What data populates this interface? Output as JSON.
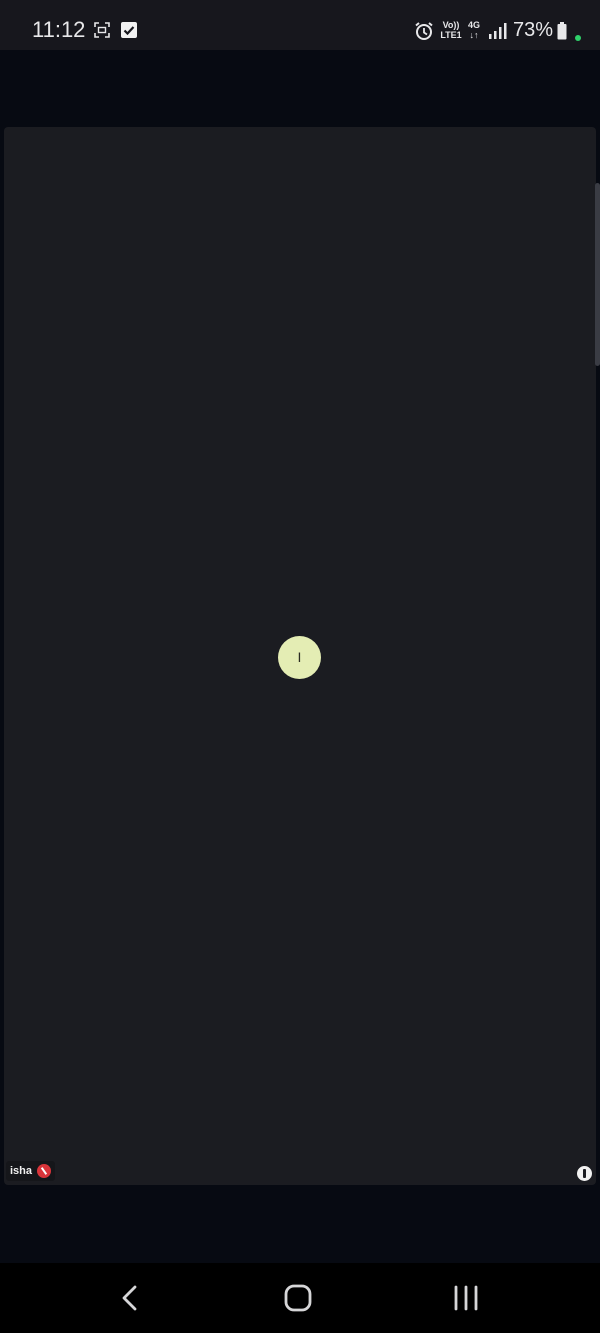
{
  "status_bar": {
    "time": "11:12",
    "volte_line1": "Vo))",
    "volte_line2": "LTE1",
    "network_type": "4G",
    "battery_percent": "73%",
    "icons": [
      "screenshot-icon",
      "check-icon",
      "alarm-icon",
      "volte-icon",
      "network-4g-icon",
      "signal-icon",
      "battery-icon"
    ],
    "charging_dot_color": "#2fd16a"
  },
  "meeting": {
    "participant": {
      "avatar_initial": "I",
      "avatar_color": "#e4edb4",
      "name": "isha",
      "muted": true
    }
  },
  "navigation": {
    "buttons": [
      "back",
      "home",
      "recents"
    ]
  }
}
